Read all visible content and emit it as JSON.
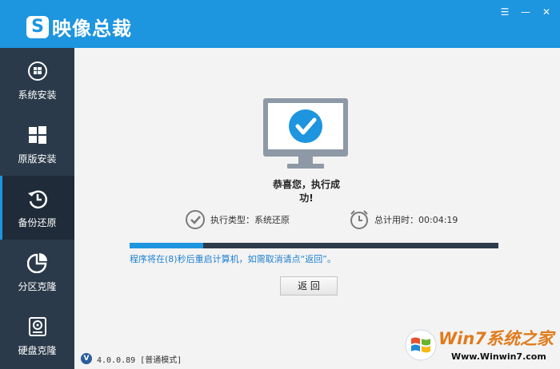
{
  "app": {
    "title": "映像总裁",
    "logo_letter": "S"
  },
  "window_controls": {
    "menu": "☰",
    "minimize": "—",
    "close": "✕"
  },
  "sidebar": {
    "items": [
      {
        "label": "系统安装",
        "icon": "windows-globe-icon"
      },
      {
        "label": "原版安装",
        "icon": "windows-logo-icon"
      },
      {
        "label": "备份还原",
        "icon": "clock-restore-icon",
        "active": true
      },
      {
        "label": "分区克隆",
        "icon": "pie-chart-icon"
      },
      {
        "label": "硬盘克隆",
        "icon": "disk-icon"
      }
    ]
  },
  "main": {
    "success_message": "恭喜您，执行成功!",
    "exec_type": "执行类型：系统还原",
    "total_time": "总计用时：00:04:19",
    "progress_fraction": 0.2,
    "notice": "程序将在(8)秒后重启计算机，如需取消请点“返回”。",
    "back_button": "返 回"
  },
  "status": {
    "badge": "V",
    "version": "4.0.0.89 [普通模式]"
  },
  "watermark": {
    "brand": "Win7系统之家",
    "url": "Www.Winwin7.com"
  },
  "colors": {
    "accent": "#1d95df",
    "sidebar": "#2b3a4a",
    "sidebar_active": "#1f2b38",
    "progress_track": "#2d3b4b"
  }
}
